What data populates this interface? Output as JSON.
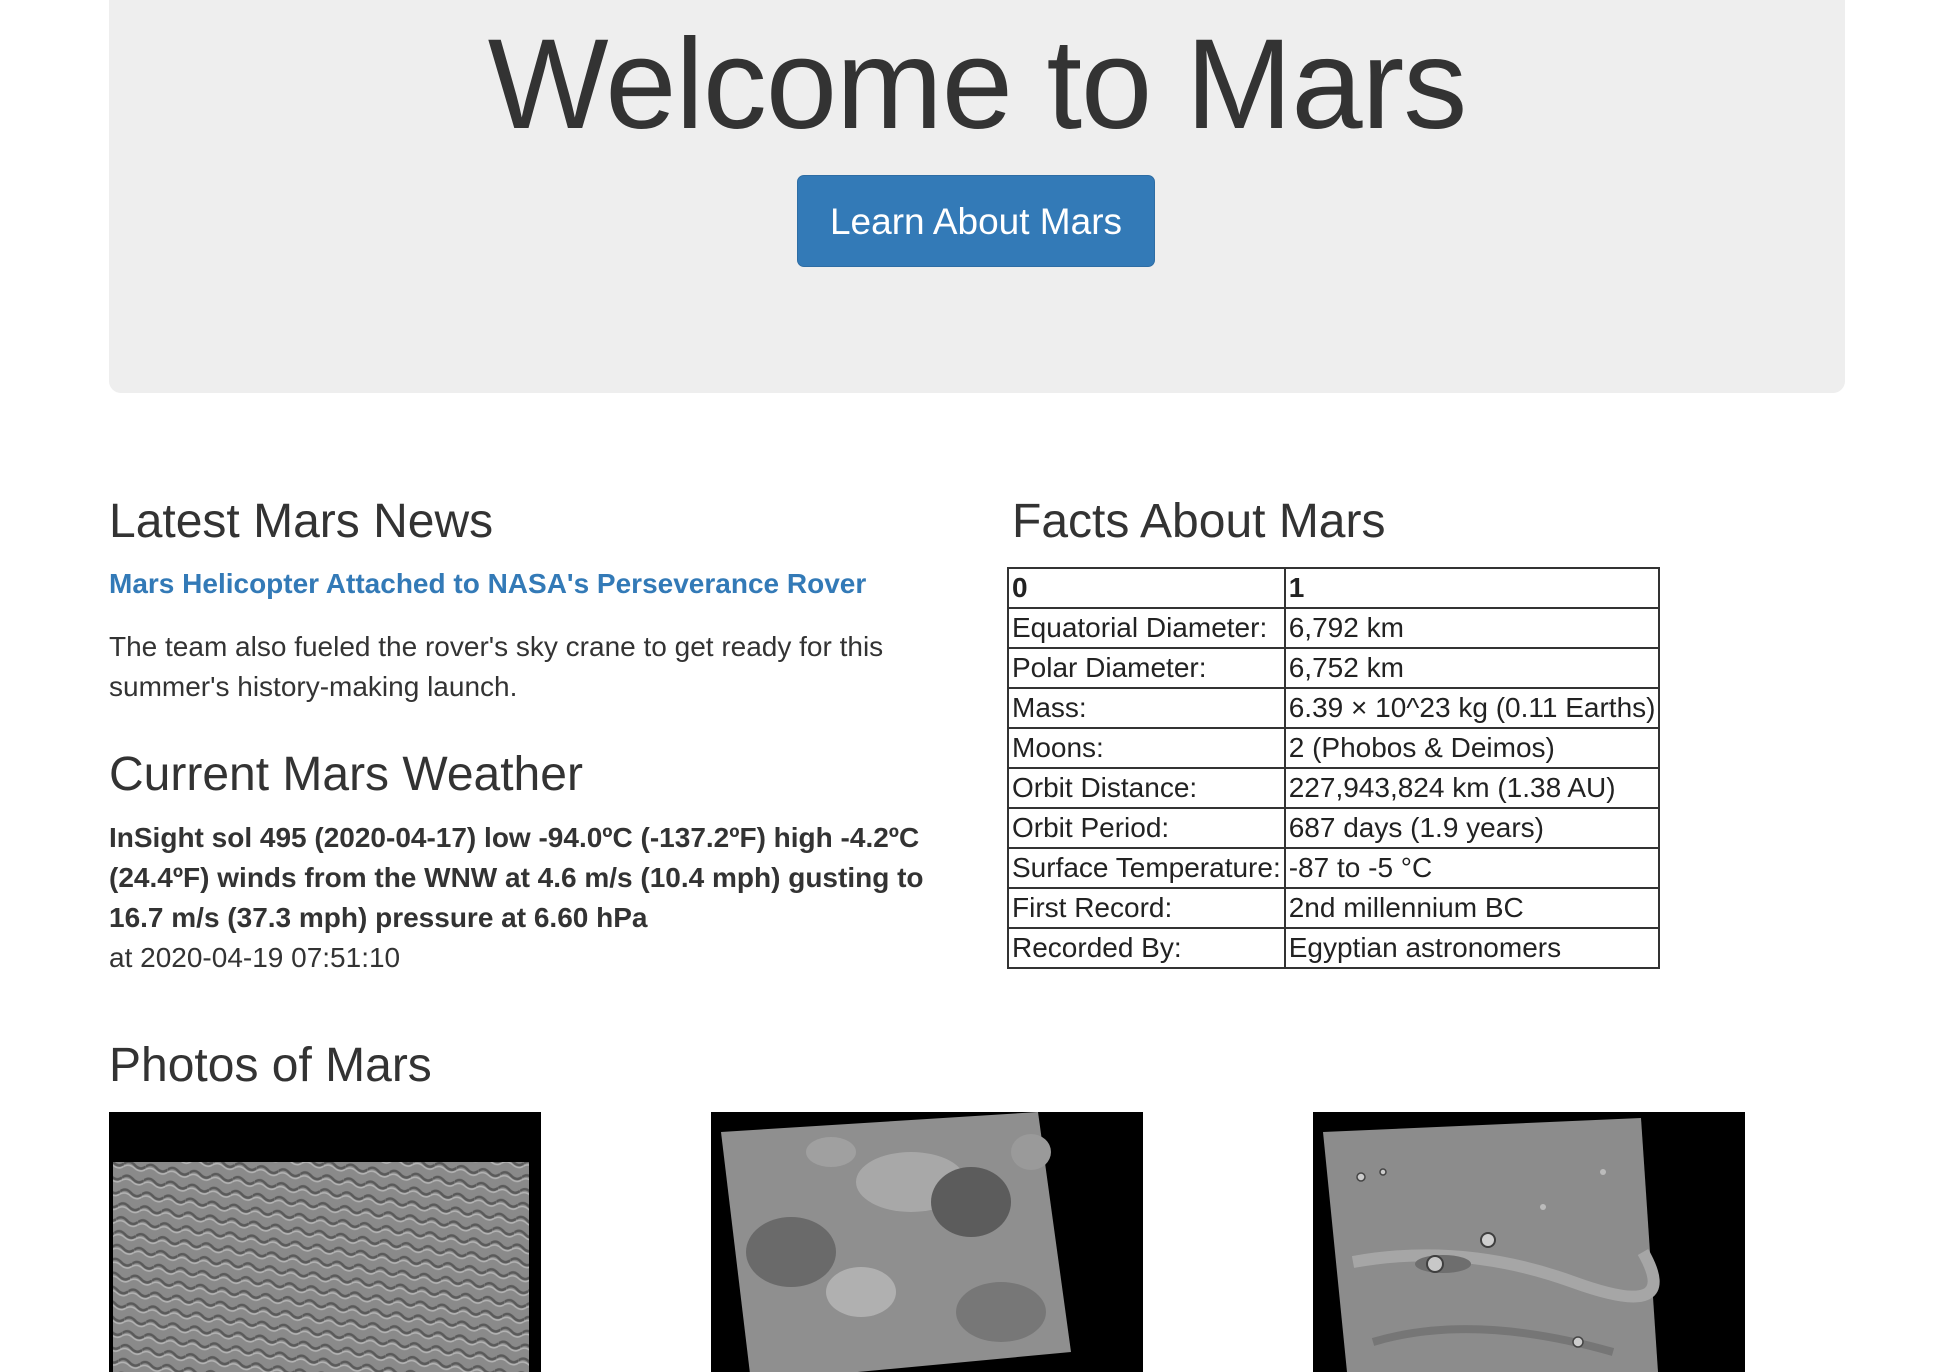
{
  "hero": {
    "title": "Welcome to Mars",
    "button_label": "Learn About Mars",
    "button_color": "#337ab7"
  },
  "news": {
    "heading": "Latest Mars News",
    "title": "Mars Helicopter Attached to NASA's Perseverance Rover",
    "paragraph": "The team also fueled the rover's sky crane to get ready for this summer's history-making launch."
  },
  "weather": {
    "heading": "Current Mars Weather",
    "report": "InSight sol 495 (2020-04-17) low -94.0ºC (-137.2ºF) high -4.2ºC (24.4ºF) winds from the WNW at 4.6 m/s (10.4 mph) gusting to 16.7 m/s (37.3 mph) pressure at 6.60 hPa",
    "timestamp": "at 2020-04-19 07:51:10"
  },
  "facts": {
    "heading": "Facts About Mars",
    "columns": [
      "0",
      "1"
    ],
    "rows": [
      [
        "Equatorial Diameter:",
        "6,792 km"
      ],
      [
        "Polar Diameter:",
        "6,752 km"
      ],
      [
        "Mass:",
        "6.39 × 10^23 kg (0.11 Earths)"
      ],
      [
        "Moons:",
        "2 (Phobos & Deimos)"
      ],
      [
        "Orbit Distance:",
        "227,943,824 km (1.38 AU)"
      ],
      [
        "Orbit Period:",
        "687 days (1.9 years)"
      ],
      [
        "Surface Temperature:",
        "-87 to -5 °C"
      ],
      [
        "First Record:",
        "2nd millennium BC"
      ],
      [
        "Recorded By:",
        "Egyptian astronomers"
      ]
    ]
  },
  "photos": {
    "heading": "Photos of Mars"
  },
  "colors": {
    "link": "#337ab7",
    "jumbotron_bg": "#eeeeee",
    "text": "#333333"
  }
}
